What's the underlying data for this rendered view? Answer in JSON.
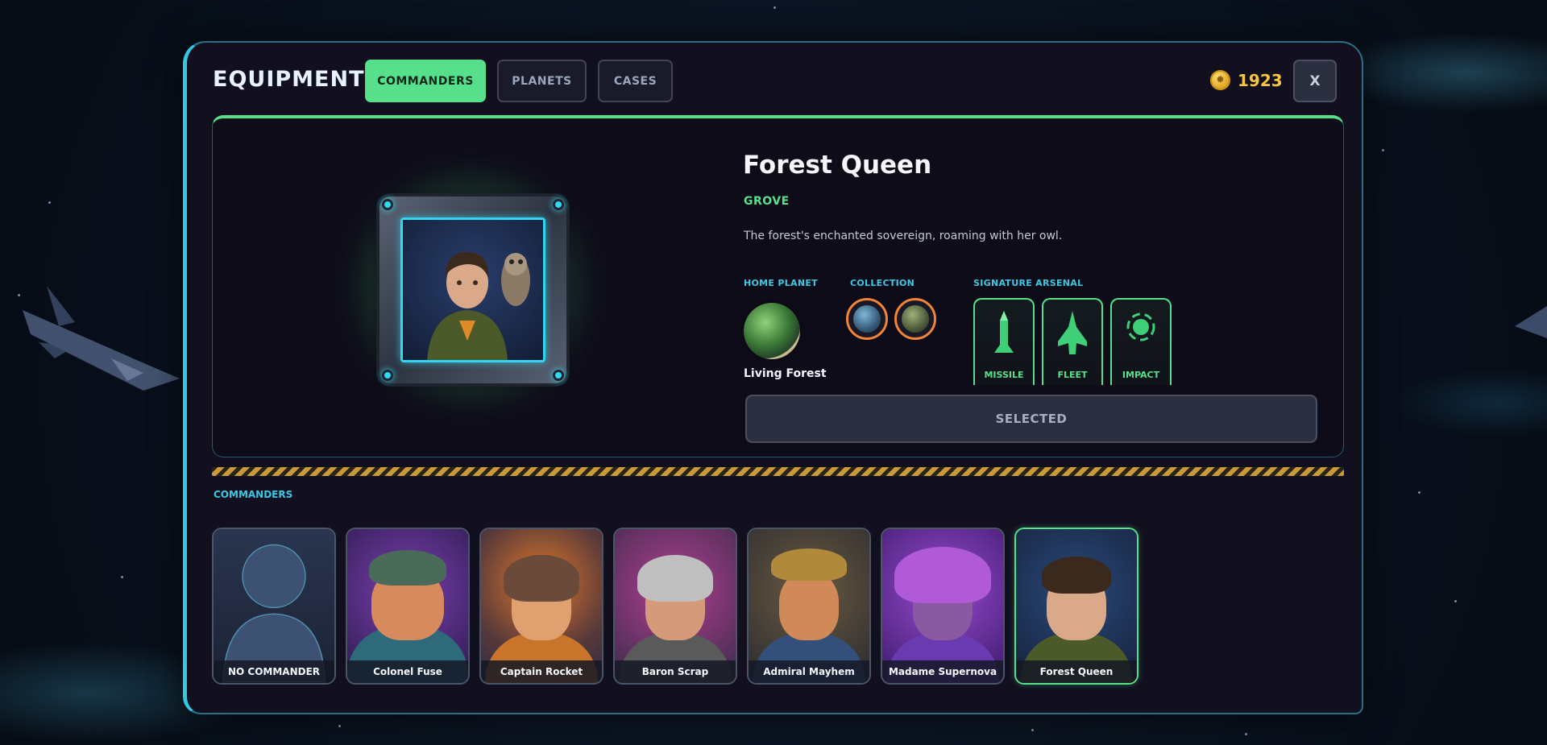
{
  "header": {
    "title": "EQUIPMENT",
    "tabs": [
      {
        "label": "COMMANDERS",
        "active": true
      },
      {
        "label": "PLANETS",
        "active": false
      },
      {
        "label": "CASES",
        "active": false
      }
    ],
    "coins": "1923",
    "close_label": "X"
  },
  "detail": {
    "name": "Forest Queen",
    "faction": "GROVE",
    "description": "The forest's enchanted sovereign, roaming with her owl.",
    "home_planet_label": "HOME PLANET",
    "home_planet_name": "Living Forest",
    "collection_label": "COLLECTION",
    "arsenal_label": "SIGNATURE ARSENAL",
    "arsenal": [
      {
        "label": "MISSILE",
        "icon": "missile-icon"
      },
      {
        "label": "FLEET",
        "icon": "fleet-ship-icon"
      },
      {
        "label": "IMPACT",
        "icon": "impact-icon"
      }
    ],
    "select_button": "SELECTED"
  },
  "roster": {
    "label": "COMMANDERS",
    "cards": [
      {
        "name": "NO COMMANDER"
      },
      {
        "name": "Colonel Fuse"
      },
      {
        "name": "Captain Rocket"
      },
      {
        "name": "Baron Scrap"
      },
      {
        "name": "Admiral Mayhem"
      },
      {
        "name": "Madame Supernova"
      },
      {
        "name": "Forest Queen",
        "selected": true
      }
    ]
  },
  "colors": {
    "accent_green": "#56e08c",
    "accent_cyan": "#33c7e0",
    "coin_gold": "#f6c543",
    "collection_ring": "#f0853a"
  }
}
